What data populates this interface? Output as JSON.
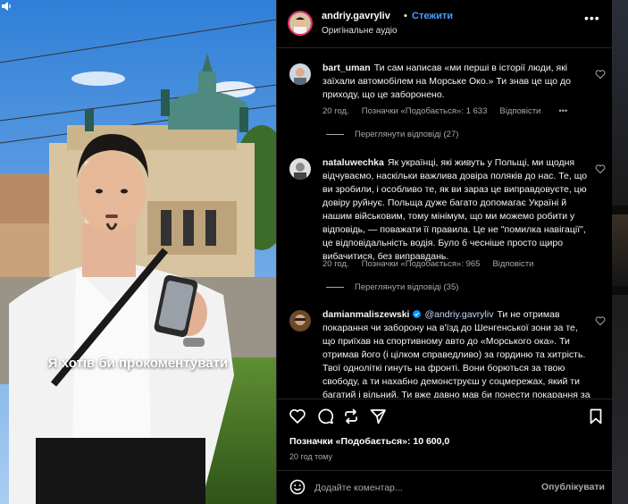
{
  "media": {
    "caption": "Я хотів би прокоментувати",
    "mute_icon": "speaker-icon"
  },
  "post": {
    "username": "andriy.gavryliv",
    "separator": "•",
    "follow_label": "Стежити",
    "audio_label": "Оригінальне аудіо",
    "more_label": "•••"
  },
  "comments": [
    {
      "username": "bart_uman",
      "text": "Ти сам написав «ми перші в історії люди, які заїхали автомобілем на Морське Око.» Ти знав це що до приходу, що це заборонено.",
      "time": "20 год.",
      "likes": "Позначки «Подобається»: 1 633",
      "reply": "Відповісти",
      "more": "•••",
      "view_replies": "Переглянути відповіді (27)"
    },
    {
      "username": "nataluwechka",
      "text": "Як українці, які живуть у Польщі, ми щодня відчуваємо, наскільки важлива довіра поляків до нас. Те, що ви зробили, і особливо те, як ви зараз це виправдовуєте, цю довіру руйнує. Польща дуже багато допомагає Україні й нашим військовим, тому мінімум, що ми можемо робити у відповідь, — поважати її правила. Це не \"помилка навігації\", це відповідальність водія. Було б чесніше просто щиро вибачитися, без виправдань.",
      "time": "20 год.",
      "likes": "Позначки «Подобається»: 965",
      "reply": "Відповісти",
      "view_replies": "Переглянути відповіді (35)"
    },
    {
      "username": "damianmaliszewski",
      "mention": "@andriy.gavryliv",
      "text": "Ти не отримав покарання чи заборону на в'їзд до Шенгенської зони за те, що приїхав на спортивному авто до «Морського ока». Ти отримав його (і цілком справедливо) за гординю та хитрість. Твої одноліткі гинуть на фронті. Вони борються за твою свободу, а ти нахабно демонструєш у соцмережах, який ти багатий і вільний. Ти вже давно мав би понести покарання за вчинене. У Польщі ми так...",
      "verified": true
    }
  ],
  "actions": {
    "like_icon": "heart-icon",
    "comment_icon": "comment-icon",
    "repost_icon": "repost-icon",
    "share_icon": "share-icon",
    "save_icon": "bookmark-icon",
    "likes_total": "Позначки «Подобається»: 10 600,0",
    "time_ago": "20 год тому"
  },
  "composer": {
    "placeholder": "Додайте коментар...",
    "publish_label": "Опублікувати",
    "emoji_icon": "emoji-icon"
  },
  "colors": {
    "link": "#4a9dff",
    "secondary_text": "#a8a8a8",
    "background": "#000000"
  }
}
